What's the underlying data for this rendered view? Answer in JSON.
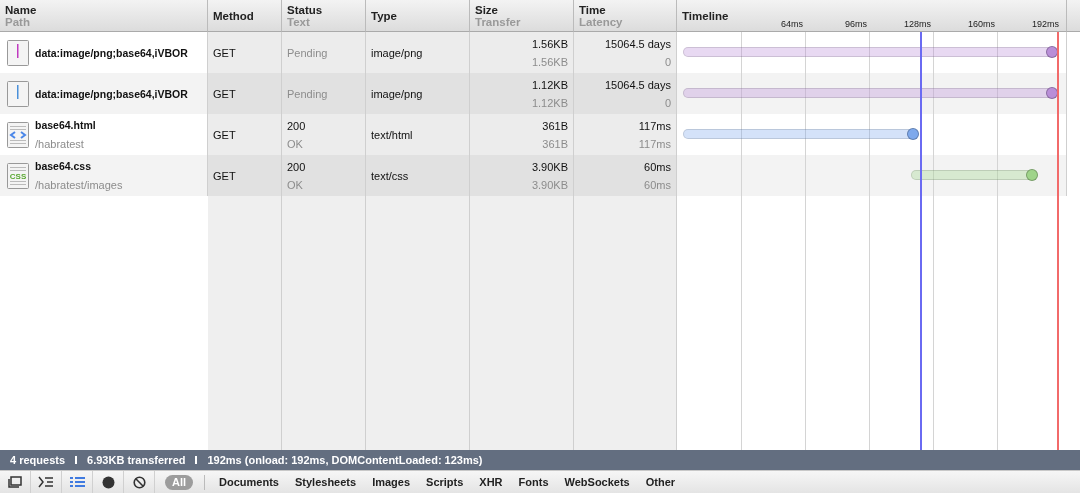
{
  "columns": [
    {
      "title": "Name",
      "subtitle": "Path"
    },
    {
      "title": "Method"
    },
    {
      "title": "Status",
      "subtitle": "Text"
    },
    {
      "title": "Type"
    },
    {
      "title": "Size",
      "subtitle": "Transfer"
    },
    {
      "title": "Time",
      "subtitle": "Latency"
    },
    {
      "title": "Timeline"
    }
  ],
  "requests": [
    {
      "kind": "image",
      "name": "data:image/png;base64,iVBOR",
      "method": "GET",
      "status": "Pending",
      "pending": true,
      "type": "image/png",
      "size": "1.56KB",
      "transfer": "1.56KB",
      "time": "15064.5 days",
      "latency": "0",
      "color": "#b98ed8"
    },
    {
      "kind": "image",
      "name": "data:image/png;base64,iVBOR",
      "method": "GET",
      "status": "Pending",
      "pending": true,
      "type": "image/png",
      "size": "1.12KB",
      "transfer": "1.12KB",
      "time": "15064.5 days",
      "latency": "0",
      "color": "#b98ed8"
    },
    {
      "kind": "html",
      "name": "base64.html",
      "path": "/habratest",
      "method": "GET",
      "status": "200",
      "status_text": "OK",
      "pending": false,
      "type": "text/html",
      "size": "361B",
      "transfer": "361B",
      "time": "117ms",
      "latency": "117ms",
      "color": "#7ea9ec"
    },
    {
      "kind": "css",
      "icon_text": "CSS",
      "name": "base64.css",
      "path": "/habratest/images",
      "method": "GET",
      "status": "200",
      "status_text": "OK",
      "pending": false,
      "type": "text/css",
      "size": "3.90KB",
      "transfer": "3.90KB",
      "time": "60ms",
      "latency": "60ms",
      "color": "#9fd48a"
    }
  ],
  "timeline": {
    "tick_labels": [
      "64ms",
      "96ms",
      "128ms",
      "160ms",
      "192ms"
    ],
    "markers": [
      {
        "kind": "domcontentloaded",
        "color": "#6a6af2"
      },
      {
        "kind": "onload",
        "color": "#f26a6a"
      }
    ]
  },
  "status_bar": [
    "4 requests",
    "6.93KB transferred",
    "192ms (onload: 192ms, DOMContentLoaded: 123ms)"
  ],
  "toolbar": {
    "buttons": [
      {
        "kind": "dock",
        "selected": false
      },
      {
        "kind": "console",
        "selected": false
      },
      {
        "kind": "list",
        "selected": true
      },
      {
        "kind": "record",
        "selected": false
      },
      {
        "kind": "clear",
        "selected": false
      }
    ],
    "filters": [
      {
        "label": "All",
        "selected": true
      },
      {
        "label": "Documents",
        "selected": false
      },
      {
        "label": "Stylesheets",
        "selected": false
      },
      {
        "label": "Images",
        "selected": false
      },
      {
        "label": "Scripts",
        "selected": false
      },
      {
        "label": "XHR",
        "selected": false
      },
      {
        "label": "Fonts",
        "selected": false
      },
      {
        "label": "WebSockets",
        "selected": false
      },
      {
        "label": "Other",
        "selected": false
      }
    ]
  }
}
